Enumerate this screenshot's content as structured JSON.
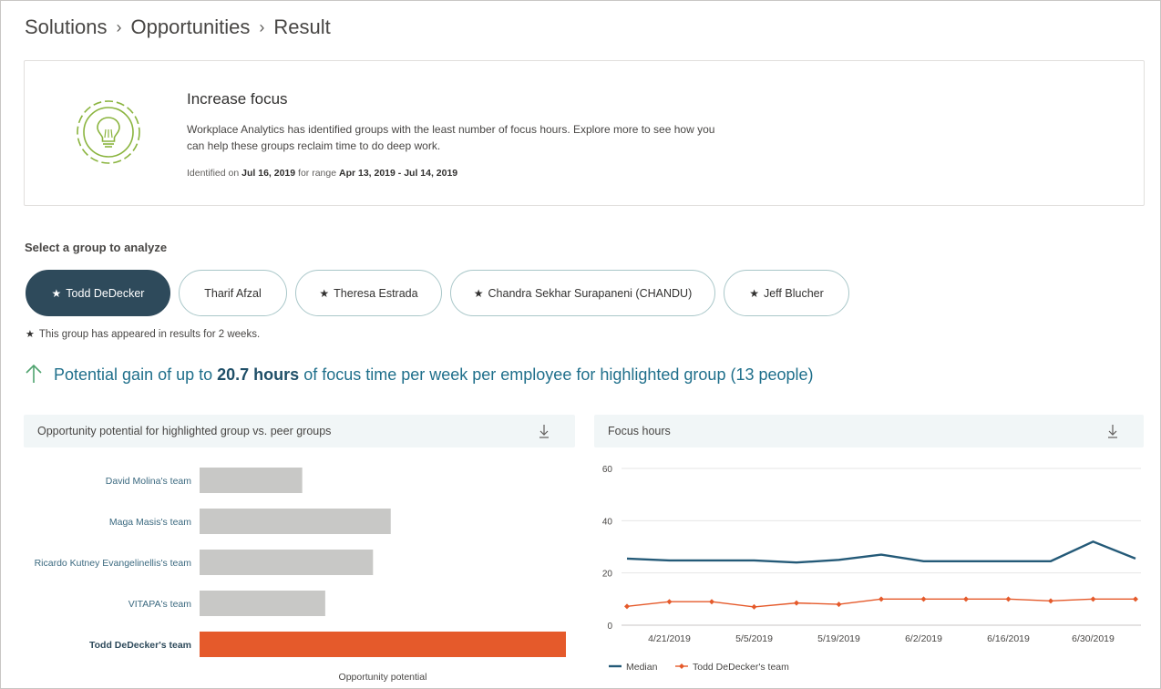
{
  "breadcrumb": {
    "items": [
      "Solutions",
      "Opportunities",
      "Result"
    ]
  },
  "insight": {
    "title": "Increase focus",
    "description": "Workplace Analytics has identified groups with the least number of focus hours. Explore more to see how you can help these groups reclaim time to do deep work.",
    "identified_prefix": "Identified on ",
    "identified_date": "Jul 16, 2019",
    "range_prefix": " for range ",
    "range": "Apr 13, 2019 - Jul 14, 2019",
    "icon": "lightbulb-icon"
  },
  "groups": {
    "label": "Select a group to analyze",
    "items": [
      {
        "label": "Todd DeDecker",
        "starred": true,
        "active": true
      },
      {
        "label": "Tharif Afzal",
        "starred": false,
        "active": false
      },
      {
        "label": "Theresa Estrada",
        "starred": true,
        "active": false
      },
      {
        "label": "Chandra Sekhar Surapaneni (CHANDU)",
        "starred": true,
        "active": false
      },
      {
        "label": "Jeff Blucher",
        "starred": true,
        "active": false
      }
    ],
    "note": "This group has appeared in results for 2 weeks."
  },
  "gain": {
    "prefix": "Potential gain of up to ",
    "value": "20.7 hours",
    "suffix": " of focus time per week per employee for highlighted group (13 people)"
  },
  "colors": {
    "accent": "#2e4a5b",
    "highlight": "#e55a2b",
    "bar_gray": "#c8c8c6",
    "median": "#245a78",
    "team_line": "#e55a2b"
  },
  "panels": {
    "left_title": "Opportunity potential for highlighted group vs. peer groups",
    "right_title": "Focus hours"
  },
  "chart_data": [
    {
      "type": "bar",
      "orientation": "horizontal",
      "title": "Opportunity potential for highlighted group vs. peer groups",
      "categories": [
        "David Molina's team",
        "Maga Masis's team",
        "Ricardo Kutney Evangelinellis's team",
        "VITAPA's team",
        "Todd DeDecker's team"
      ],
      "values": [
        5.8,
        10.8,
        9.8,
        7.1,
        20.7
      ],
      "highlighted": "Todd DeDecker's team",
      "xlabel": "Opportunity potential",
      "xlim": [
        0,
        20.7
      ],
      "grid": false
    },
    {
      "type": "line",
      "title": "Focus hours",
      "x": [
        "4/14/2019",
        "4/21/2019",
        "4/28/2019",
        "5/5/2019",
        "5/12/2019",
        "5/19/2019",
        "5/26/2019",
        "6/2/2019",
        "6/9/2019",
        "6/16/2019",
        "6/23/2019",
        "6/30/2019",
        "7/7/2019"
      ],
      "xticks": [
        "4/21/2019",
        "5/5/2019",
        "5/19/2019",
        "6/2/2019",
        "6/16/2019",
        "6/30/2019"
      ],
      "series": [
        {
          "name": "Median",
          "values": [
            25.5,
            24.8,
            24.8,
            24.8,
            24.0,
            25.0,
            27.0,
            24.5,
            24.5,
            24.5,
            24.5,
            32.0,
            25.5
          ]
        },
        {
          "name": "Todd DeDecker's team",
          "values": [
            7.2,
            9.0,
            9.0,
            7.0,
            8.5,
            8.0,
            10.0,
            10.0,
            10.0,
            10.0,
            9.3,
            10.0,
            10.0
          ]
        }
      ],
      "ylim": [
        0,
        60
      ],
      "yticks": [
        0,
        20,
        40,
        60
      ],
      "grid": true,
      "legend_position": "bottom-left"
    }
  ]
}
